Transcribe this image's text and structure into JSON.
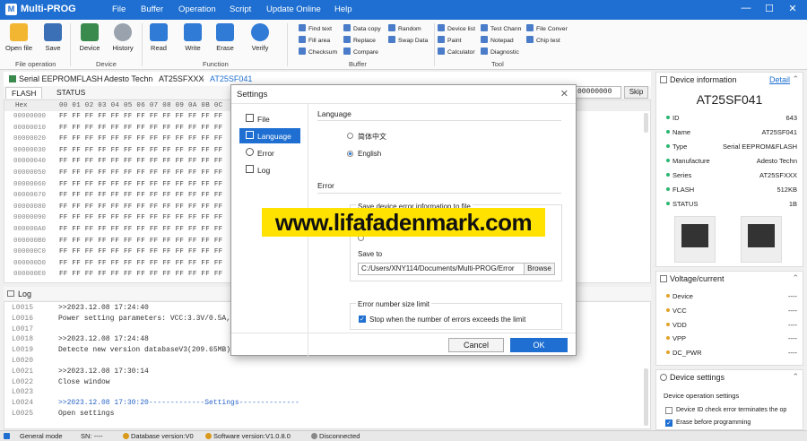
{
  "app": {
    "title": "Multi-PROG"
  },
  "menu": [
    "File",
    "Buffer",
    "Operation",
    "Script",
    "Update Online",
    "Help"
  ],
  "window_controls": {
    "minimize": "—",
    "maximize": "☐",
    "close": "✕"
  },
  "ribbon": {
    "file_operation": {
      "label": "File operation",
      "open": "Open file",
      "save": "Save"
    },
    "device": {
      "label": "Device",
      "device": "Device",
      "history": "History"
    },
    "function": {
      "label": "Function",
      "read": "Read",
      "write": "Write",
      "erase": "Erase",
      "verify": "Verify"
    },
    "buffer": {
      "label": "Buffer",
      "items": [
        "Find text",
        "Fill area",
        "Checksum",
        "Data copy",
        "Replace",
        "Compare",
        "Random",
        "Swap Data"
      ]
    },
    "tool": {
      "label": "Tool",
      "items": [
        "Device list",
        "Paint",
        "Calculator",
        "Test Chann",
        "Notepad",
        "Diagnostic",
        "File Conver",
        "Chip test"
      ]
    }
  },
  "breadcrumb": [
    "Serial EEPROMFLASH",
    "Adesto Techn",
    "AT25SFXXX",
    "AT25SF041"
  ],
  "tabs": [
    "FLASH",
    "STATUS"
  ],
  "skip": {
    "value": "00000000",
    "button": "Skip"
  },
  "hex": {
    "header_addr": "Hex",
    "header_cols": "00 01 02 03 04 05 06 07 08 09 0A 0B 0C",
    "rows": [
      {
        "addr": "00000000",
        "bytes": "FF FF FF FF FF FF FF FF FF FF FF FF FF"
      },
      {
        "addr": "00000010",
        "bytes": "FF FF FF FF FF FF FF FF FF FF FF FF FF"
      },
      {
        "addr": "00000020",
        "bytes": "FF FF FF FF FF FF FF FF FF FF FF FF FF"
      },
      {
        "addr": "00000030",
        "bytes": "FF FF FF FF FF FF FF FF FF FF FF FF FF"
      },
      {
        "addr": "00000040",
        "bytes": "FF FF FF FF FF FF FF FF FF FF FF FF FF"
      },
      {
        "addr": "00000050",
        "bytes": "FF FF FF FF FF FF FF FF FF FF FF FF FF"
      },
      {
        "addr": "00000060",
        "bytes": "FF FF FF FF FF FF FF FF FF FF FF FF FF"
      },
      {
        "addr": "00000070",
        "bytes": "FF FF FF FF FF FF FF FF FF FF FF FF FF"
      },
      {
        "addr": "00000080",
        "bytes": "FF FF FF FF FF FF FF FF FF FF FF FF FF"
      },
      {
        "addr": "00000090",
        "bytes": "FF FF FF FF FF FF FF FF FF FF FF FF FF"
      },
      {
        "addr": "000000A0",
        "bytes": "FF FF FF FF FF FF FF FF FF FF FF FF FF"
      },
      {
        "addr": "000000B0",
        "bytes": "FF FF FF FF FF FF FF FF FF FF FF FF FF"
      },
      {
        "addr": "000000C0",
        "bytes": "FF FF FF FF FF FF FF FF FF FF FF FF FF"
      },
      {
        "addr": "000000D0",
        "bytes": "FF FF FF FF FF FF FF FF FF FF FF FF FF"
      },
      {
        "addr": "000000E0",
        "bytes": "FF FF FF FF FF FF FF FF FF FF FF FF FF"
      }
    ]
  },
  "log": {
    "title": "Log",
    "lines": [
      {
        "n": "L0015",
        "t": ">>2023.12.08 17:24:40",
        "hl": false
      },
      {
        "n": "L0016",
        "t": "Power setting parameters: VCC:3.3V/0.5A,",
        "hl": false
      },
      {
        "n": "L0017",
        "t": "",
        "hl": false
      },
      {
        "n": "L0018",
        "t": ">>2023.12.08 17:24:48",
        "hl": false
      },
      {
        "n": "L0019",
        "t": "Detecte new version databaseV3(209.65MB)",
        "hl": false
      },
      {
        "n": "L0020",
        "t": "",
        "hl": false
      },
      {
        "n": "L0021",
        "t": ">>2023.12.08 17:30:14",
        "hl": false
      },
      {
        "n": "L0022",
        "t": "Close window",
        "hl": false
      },
      {
        "n": "L0023",
        "t": "",
        "hl": false
      },
      {
        "n": "L0024",
        "t": ">>2023.12.08 17:30:20-------------Settings--------------",
        "hl": true
      },
      {
        "n": "L0025",
        "t": "Open settings",
        "hl": false
      }
    ]
  },
  "status": {
    "mode": "General mode",
    "sn": "SN:  ----",
    "db": "Database version:V0",
    "sw": "Software version:V1.0.8.0",
    "conn": "Disconnected"
  },
  "device_info": {
    "title": "Device information",
    "detail": "Detail",
    "chip": "AT25SF041",
    "rows": [
      {
        "k": "ID",
        "v": "643"
      },
      {
        "k": "Name",
        "v": "AT25SF041"
      },
      {
        "k": "Type",
        "v": "Serial EEPROM&FLASH"
      },
      {
        "k": "Manufacture",
        "v": "Adesto Techn"
      },
      {
        "k": "Series",
        "v": "AT25SFXXX"
      },
      {
        "k": "FLASH",
        "v": "512KB"
      },
      {
        "k": "STATUS",
        "v": "1B"
      }
    ]
  },
  "voltage": {
    "title": "Voltage/current",
    "rows": [
      {
        "k": "Device",
        "v": "----"
      },
      {
        "k": "VCC",
        "v": "----"
      },
      {
        "k": "VDD",
        "v": "----"
      },
      {
        "k": "VPP",
        "v": "----"
      },
      {
        "k": "DC_PWR",
        "v": "----"
      }
    ]
  },
  "device_settings": {
    "title": "Device settings",
    "section": "Device operation settings",
    "opt1": "Device ID check error terminates the op",
    "opt2": "Erase before programming"
  },
  "settings_dialog": {
    "title": "Settings",
    "nav": [
      "File",
      "Language",
      "Error",
      "Log"
    ],
    "language_section": "Language",
    "lang_chinese": "简体中文",
    "lang_english": "English",
    "error_section": "Error",
    "save_error_label": "Save device error information to file",
    "save_to_label": "Save to",
    "save_path": "C:/Users/XNY114/Documents/Multi-PROG/Error",
    "browse": "Browse",
    "errsize_label": "Error number size limit",
    "stop_label": "Stop when the number of errors exceeds the limit",
    "cancel": "Cancel",
    "ok": "OK"
  },
  "watermark": "www.lifafadenmark.com",
  "colors": {
    "accent": "#1e6fd1",
    "watermark_bg": "#ffe200"
  }
}
